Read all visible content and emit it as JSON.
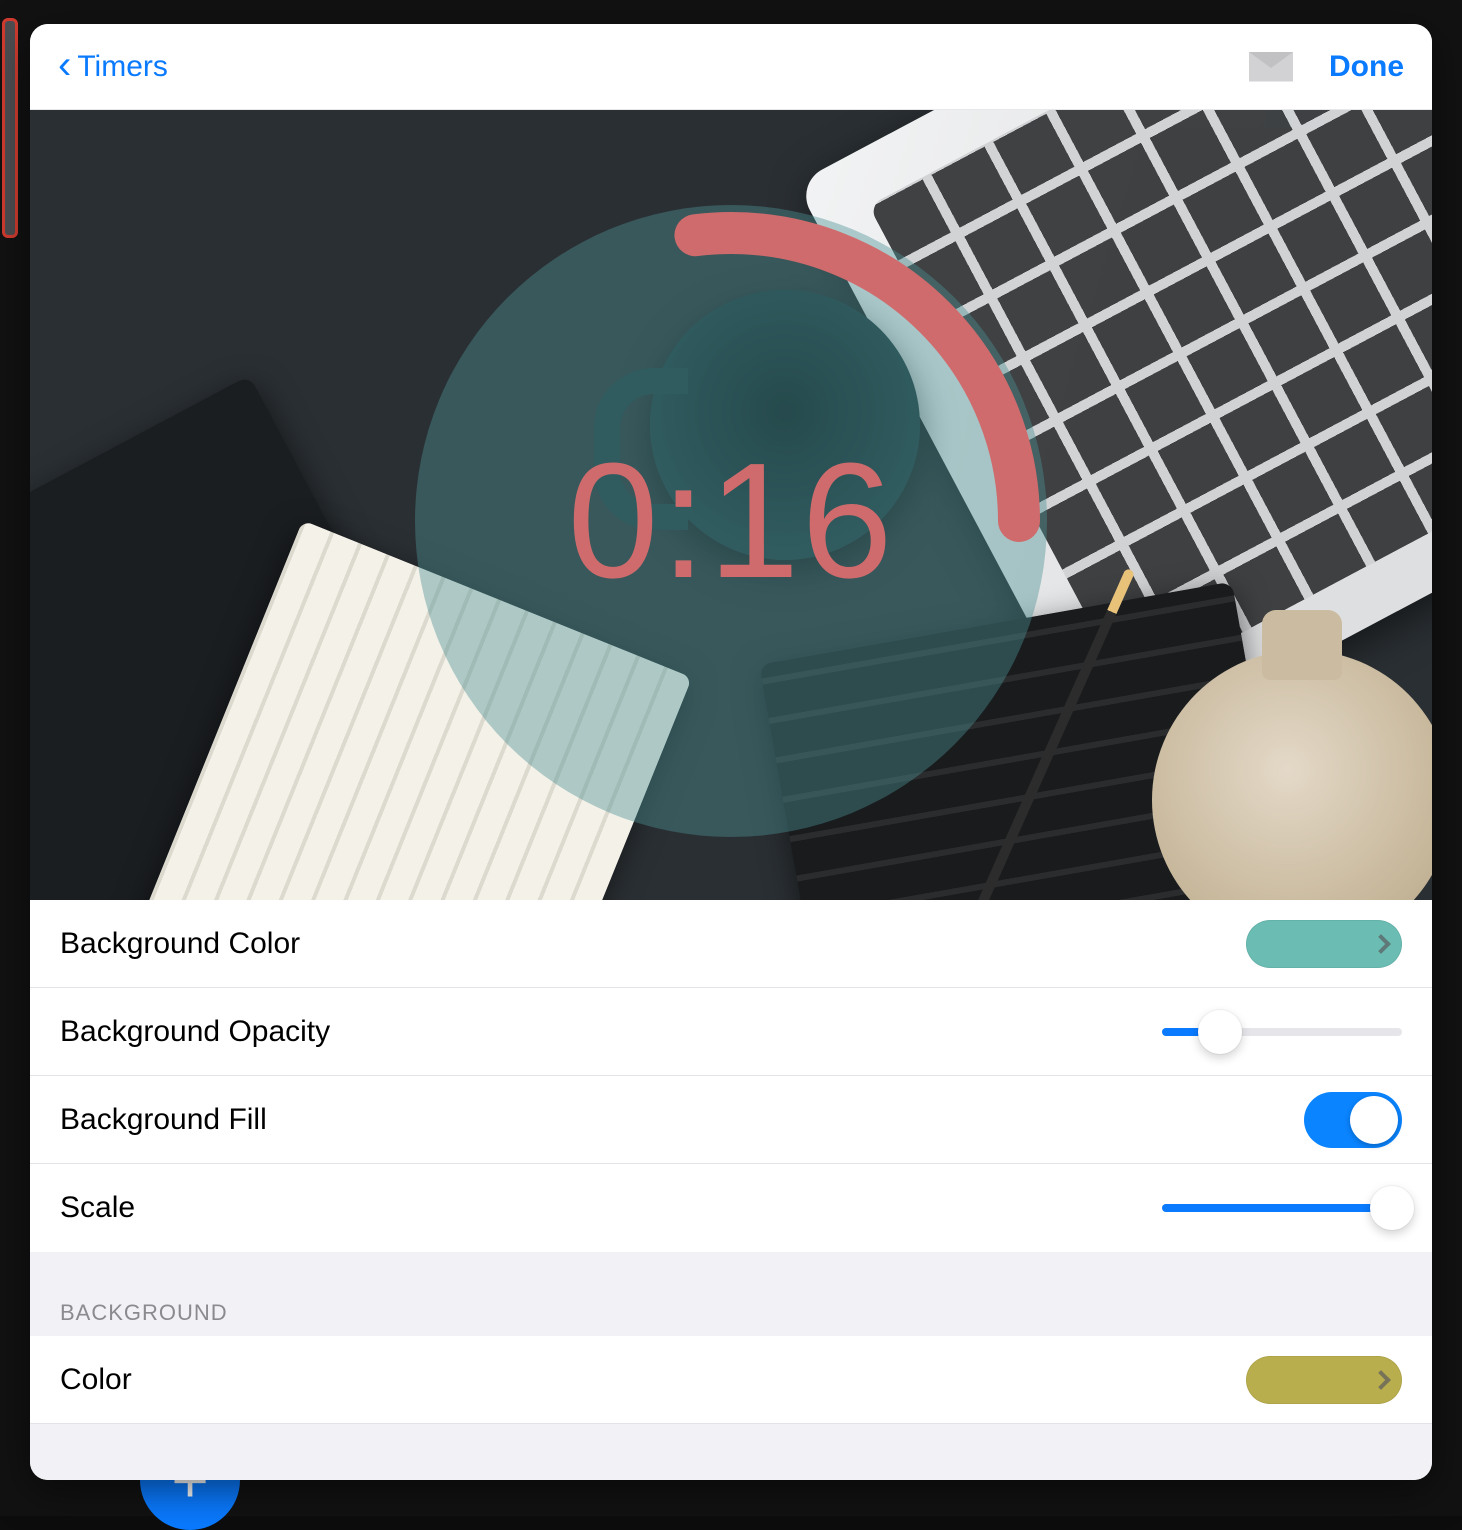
{
  "nav": {
    "back_label": "Timers",
    "done_label": "Done"
  },
  "timer": {
    "display": "0:16",
    "ring_color": "#cf6b6c",
    "circle_bg": "rgba(76,146,148,0.42)",
    "progress_fraction": 0.27
  },
  "settings": {
    "rows": {
      "bg_color": {
        "label": "Background Color",
        "swatch": "#6bbdb4"
      },
      "bg_opacity": {
        "label": "Background Opacity",
        "value": 0.24
      },
      "bg_fill": {
        "label": "Background Fill",
        "on": true
      },
      "scale": {
        "label": "Scale",
        "value": 0.96
      }
    },
    "section2": {
      "header": "BACKGROUND",
      "color": {
        "label": "Color",
        "swatch": "#b9ae4e"
      }
    }
  },
  "colors": {
    "accent": "#0a7aff"
  }
}
